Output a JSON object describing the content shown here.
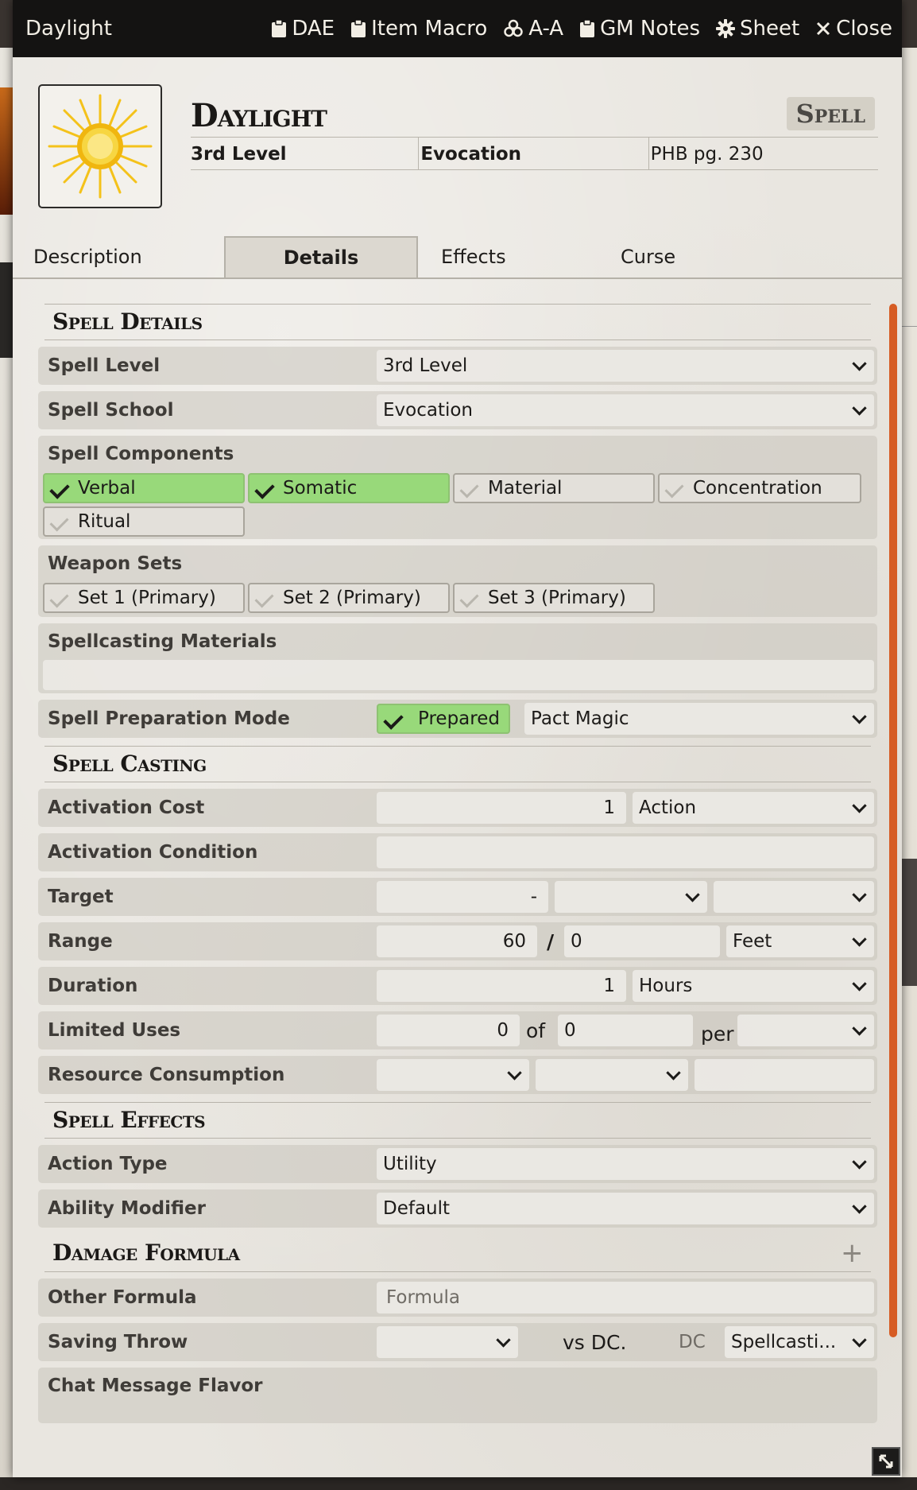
{
  "window": {
    "title": "Daylight"
  },
  "toolbar": {
    "dae": "DAE",
    "item_macro": "Item Macro",
    "aa": "A-A",
    "gm_notes": "GM Notes",
    "sheet": "Sheet",
    "close": "Close"
  },
  "header": {
    "name": "Daylight",
    "type": "Spell",
    "level": "3rd Level",
    "school": "Evocation",
    "source": "PHB pg. 230"
  },
  "tabs": [
    "Description",
    "Details",
    "Effects",
    "Curse"
  ],
  "spell_details": {
    "heading": "Spell Details",
    "level_label": "Spell Level",
    "level_value": "3rd Level",
    "school_label": "Spell School",
    "school_value": "Evocation",
    "components_label": "Spell Components",
    "components": [
      {
        "label": "Verbal",
        "checked": true
      },
      {
        "label": "Somatic",
        "checked": true
      },
      {
        "label": "Material",
        "checked": false
      },
      {
        "label": "Concentration",
        "checked": false
      },
      {
        "label": "Ritual",
        "checked": false
      }
    ],
    "weapon_sets_label": "Weapon Sets",
    "weapon_sets": [
      {
        "label": "Set 1 (Primary)",
        "checked": false
      },
      {
        "label": "Set 2 (Primary)",
        "checked": false
      },
      {
        "label": "Set 3 (Primary)",
        "checked": false
      }
    ],
    "materials_label": "Spellcasting Materials",
    "materials_value": "",
    "prep_label": "Spell Preparation Mode",
    "prepared_label": "Prepared",
    "prep_mode": "Pact Magic"
  },
  "spell_casting": {
    "heading": "Spell Casting",
    "activation_cost_label": "Activation Cost",
    "activation_cost": "1",
    "activation_type": "Action",
    "activation_condition_label": "Activation Condition",
    "activation_condition": "",
    "target_label": "Target",
    "target_value": "-",
    "range_label": "Range",
    "range_value": "60",
    "range_sep": "/",
    "range_long": "0",
    "range_units": "Feet",
    "duration_label": "Duration",
    "duration_value": "1",
    "duration_units": "Hours",
    "uses_label": "Limited Uses",
    "uses_value": "0",
    "uses_of": "of",
    "uses_max": "0",
    "uses_per": "per",
    "resource_label": "Resource Consumption"
  },
  "spell_effects": {
    "heading": "Spell Effects",
    "action_type_label": "Action Type",
    "action_type": "Utility",
    "ability_label": "Ability Modifier",
    "ability": "Default",
    "damage_heading": "Damage Formula",
    "add_symbol": "+",
    "other_formula_label": "Other Formula",
    "other_formula_placeholder": "Formula",
    "saving_throw_label": "Saving Throw",
    "vs_dc": "vs DC.",
    "dc": "DC",
    "dc_mode": "Spellcasti...",
    "flavor_label": "Chat Message Flavor"
  },
  "colors": {
    "accent": "#d65c24",
    "checked": "#98d97a",
    "titlebar": "#141312"
  }
}
